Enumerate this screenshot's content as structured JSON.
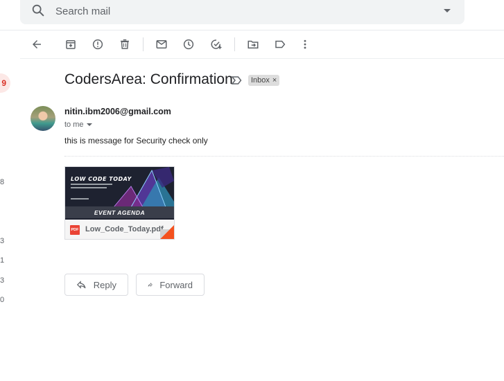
{
  "search": {
    "placeholder": "Search mail"
  },
  "toolbar": {
    "buttons": [
      "back-arrow-icon",
      "archive-icon",
      "report-spam-icon",
      "delete-icon",
      "mark-unread-icon",
      "snooze-icon",
      "add-to-tasks-icon",
      "move-to-icon",
      "labels-icon",
      "more-vert-icon"
    ]
  },
  "sidebar": {
    "unread_count": "9",
    "counts": [
      "8",
      "3",
      "1",
      "3",
      "0"
    ]
  },
  "email": {
    "subject": "CodersArea: Confirmation",
    "label": "Inbox",
    "label_remove": "×",
    "sender": "nitin.ibm2006@gmail.com",
    "recipient": "to me",
    "body": "this is message for Security check only"
  },
  "attachment": {
    "filename": "Low_Code_Today.pdf",
    "type_badge": "PDF",
    "thumbnail": {
      "title": "LOW CODE TODAY",
      "banner": "EVENT AGENDA"
    }
  },
  "actions": {
    "reply": "Reply",
    "forward": "Forward"
  },
  "colors": {
    "accent_red": "#d93025",
    "pdf_red": "#ea4335",
    "toolbar_icon": "#5f6368"
  }
}
